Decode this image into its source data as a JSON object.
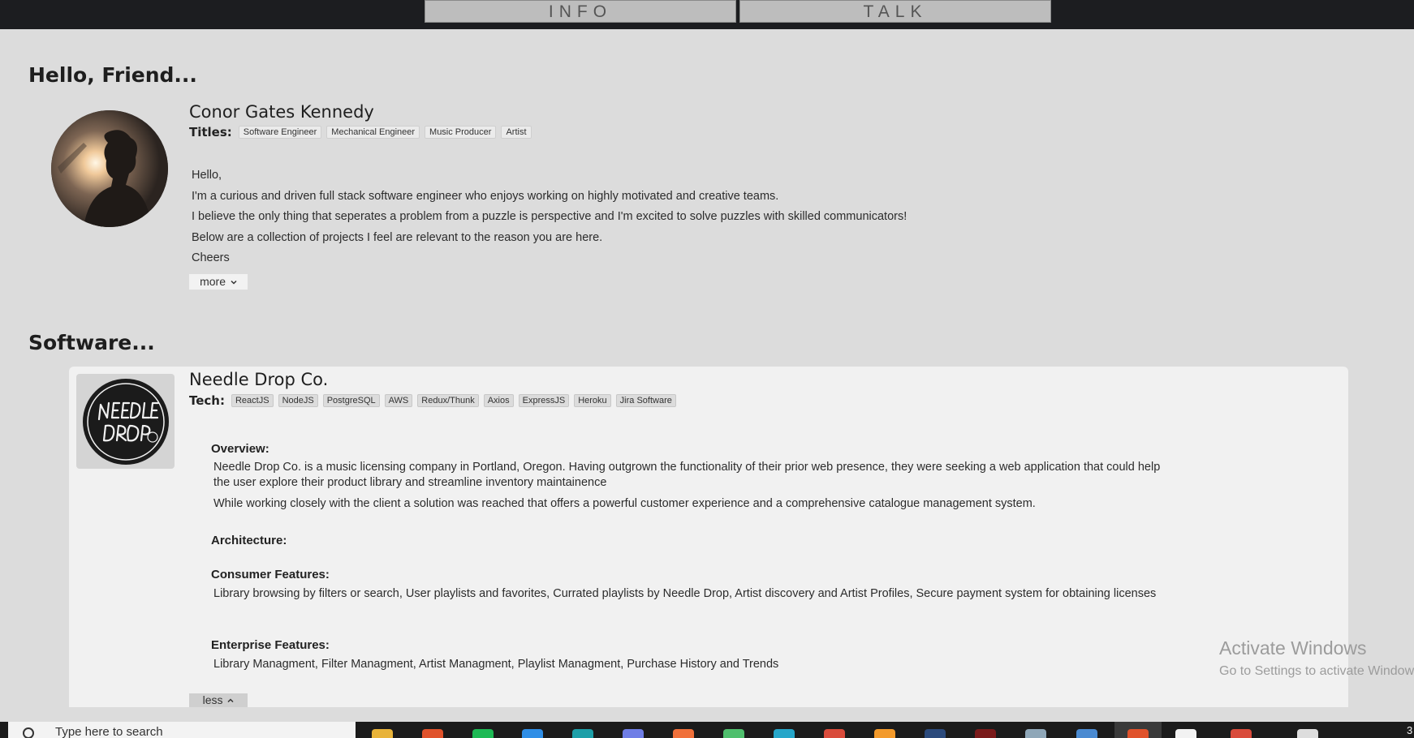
{
  "nav": {
    "tabs": [
      {
        "label": "INFO"
      },
      {
        "label": "TALK"
      }
    ]
  },
  "headings": {
    "hello": "Hello, Friend...",
    "software": "Software..."
  },
  "profile": {
    "name": "Conor Gates Kennedy",
    "titles_label": "Titles:",
    "titles": [
      "Software Engineer",
      "Mechanical Engineer",
      "Music Producer",
      "Artist"
    ],
    "intro": [
      "Hello,",
      "I'm a curious and driven full stack software engineer who enjoys working on highly motivated and creative teams.",
      "I believe the only thing that seperates a problem from a puzzle is perspective and I'm excited to solve puzzles with skilled communicators!",
      "Below are a collection of projects I feel are relevant to the reason you are here.",
      "Cheers"
    ],
    "more_label": "more",
    "more_icon": "chevron-down-icon"
  },
  "project": {
    "name": "Needle Drop Co.",
    "tech_label": "Tech:",
    "tech": [
      "ReactJS",
      "NodeJS",
      "PostgreSQL",
      "AWS",
      "Redux/Thunk",
      "Axios",
      "ExpressJS",
      "Heroku",
      "Jira Software"
    ],
    "overview_heading": "Overview:",
    "overview_1": "Needle Drop Co. is a music licensing company in Portland, Oregon. Having outgrown the functionality of their prior web presence, they were seeking a web application that could help the user explore their product library and streamline inventory maintainence",
    "overview_2": "While working closely with the client a solution was reached that offers a powerful customer experience and a comprehensive catalogue management system.",
    "architecture_heading": "Architecture:",
    "consumer_heading": "Consumer Features:",
    "consumer_text": "Library browsing by filters or search, User playlists and favorites, Currated playlists by Needle Drop, Artist discovery and Artist Profiles, Secure payment system for obtaining licenses",
    "enterprise_heading": "Enterprise Features:",
    "enterprise_text": "Library Managment, Filter Managment, Artist Managment, Playlist Managment, Purchase History and Trends",
    "less_label": "less",
    "less_icon": "chevron-up-icon",
    "logo_icon": "needle-drop-logo-icon"
  },
  "watermark": {
    "line1": "Activate Windows",
    "line2": "Go to Settings to activate Windows."
  },
  "taskbar": {
    "search_placeholder": "Type here to search",
    "clock": "3",
    "app_icons": [
      {
        "name": "file-explorer-icon",
        "color": "#e8b33a"
      },
      {
        "name": "brave-browser-icon",
        "color": "#e0522b"
      },
      {
        "name": "spotify-icon",
        "color": "#1db954"
      },
      {
        "name": "vscode-icon",
        "color": "#2f8ee6"
      },
      {
        "name": "terminal-app-icon",
        "color": "#1d9fa8"
      },
      {
        "name": "discord-icon",
        "color": "#6f7ee6"
      },
      {
        "name": "postman-icon",
        "color": "#f0703a"
      },
      {
        "name": "greenshot-icon",
        "color": "#4fbf6d"
      },
      {
        "name": "edge-icon",
        "color": "#26a6c9"
      },
      {
        "name": "chrome-icon",
        "color": "#d94b3b"
      },
      {
        "name": "firefox-icon",
        "color": "#f39a2b"
      },
      {
        "name": "powershell-icon",
        "color": "#2b4a7c"
      },
      {
        "name": "pdf-reader-icon",
        "color": "#7a1a1a"
      },
      {
        "name": "notepad-icon",
        "color": "#8fa7b8"
      },
      {
        "name": "calculator-icon",
        "color": "#4a8ad1"
      },
      {
        "name": "active-app-icon",
        "color": "#e0522b"
      },
      {
        "name": "git-icon",
        "color": "#f2f2f2"
      },
      {
        "name": "record-icon",
        "color": "#d94b3b"
      },
      {
        "name": "speaker-icon",
        "color": "#dddddd"
      }
    ]
  }
}
